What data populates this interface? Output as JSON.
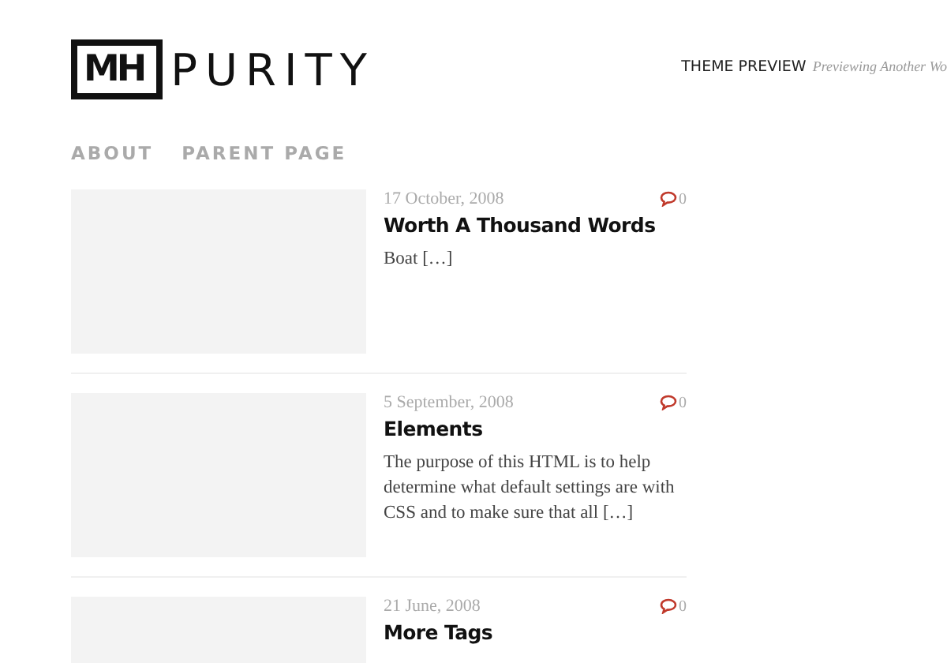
{
  "header": {
    "logo_mark": "MH",
    "logo_text": "PURITY",
    "theme_preview": "THEME PREVIEW",
    "previewing": "Previewing Another Wo"
  },
  "nav": [
    {
      "label": "ABOUT"
    },
    {
      "label": "PARENT PAGE"
    }
  ],
  "posts": [
    {
      "date": "17 October, 2008",
      "comments": "0",
      "title": "Worth A Thousand Words",
      "excerpt": "Boat […]"
    },
    {
      "date": "5 September, 2008",
      "comments": "0",
      "title": "Elements",
      "excerpt": "The purpose of this HTML is to help determine what default settings are with CSS and to make sure that all […]"
    },
    {
      "date": "21 June, 2008",
      "comments": "0",
      "title": "More Tags"
    }
  ]
}
